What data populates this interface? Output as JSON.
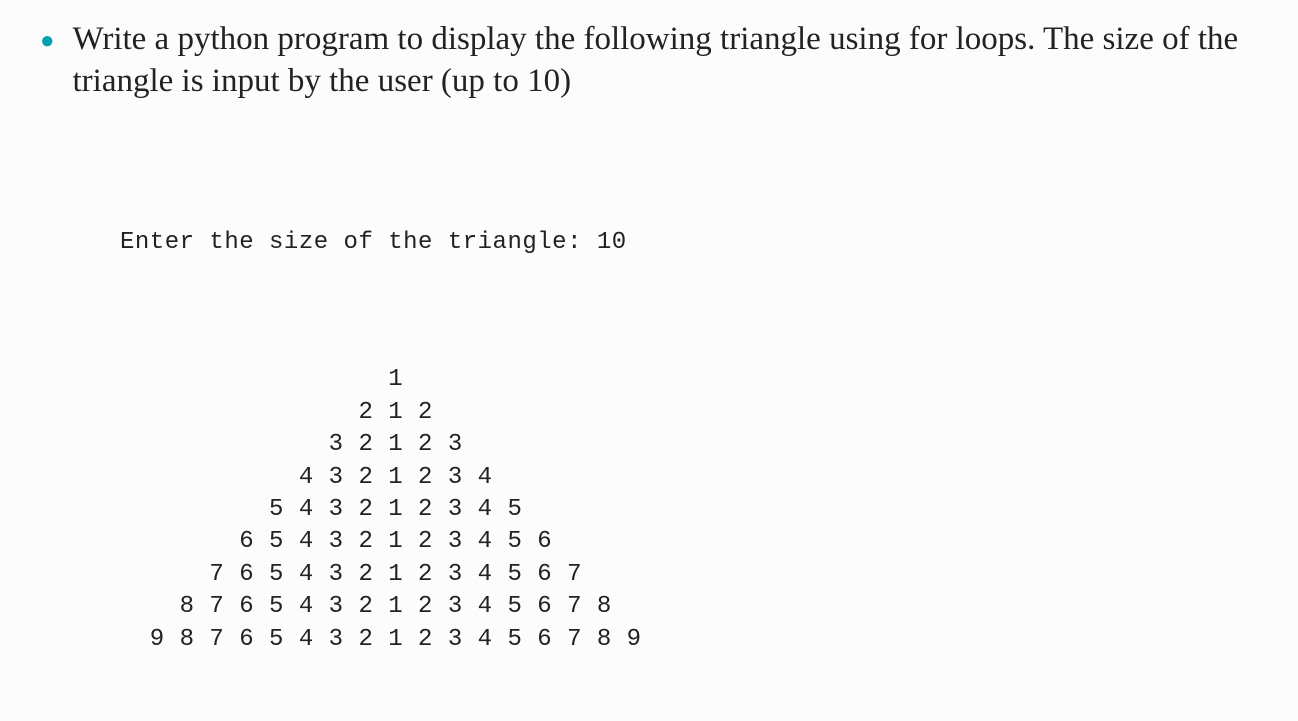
{
  "bullet": {
    "text": "Write a python program to display the following triangle using for loops. The size of the triangle is input by the user (up to 10)"
  },
  "code": {
    "prompt": "Enter the size of the triangle: 10",
    "triangle": "                  1\n                2 1 2\n              3 2 1 2 3\n            4 3 2 1 2 3 4\n          5 4 3 2 1 2 3 4 5\n        6 5 4 3 2 1 2 3 4 5 6\n      7 6 5 4 3 2 1 2 3 4 5 6 7\n    8 7 6 5 4 3 2 1 2 3 4 5 6 7 8\n  9 8 7 6 5 4 3 2 1 2 3 4 5 6 7 8 9"
  }
}
